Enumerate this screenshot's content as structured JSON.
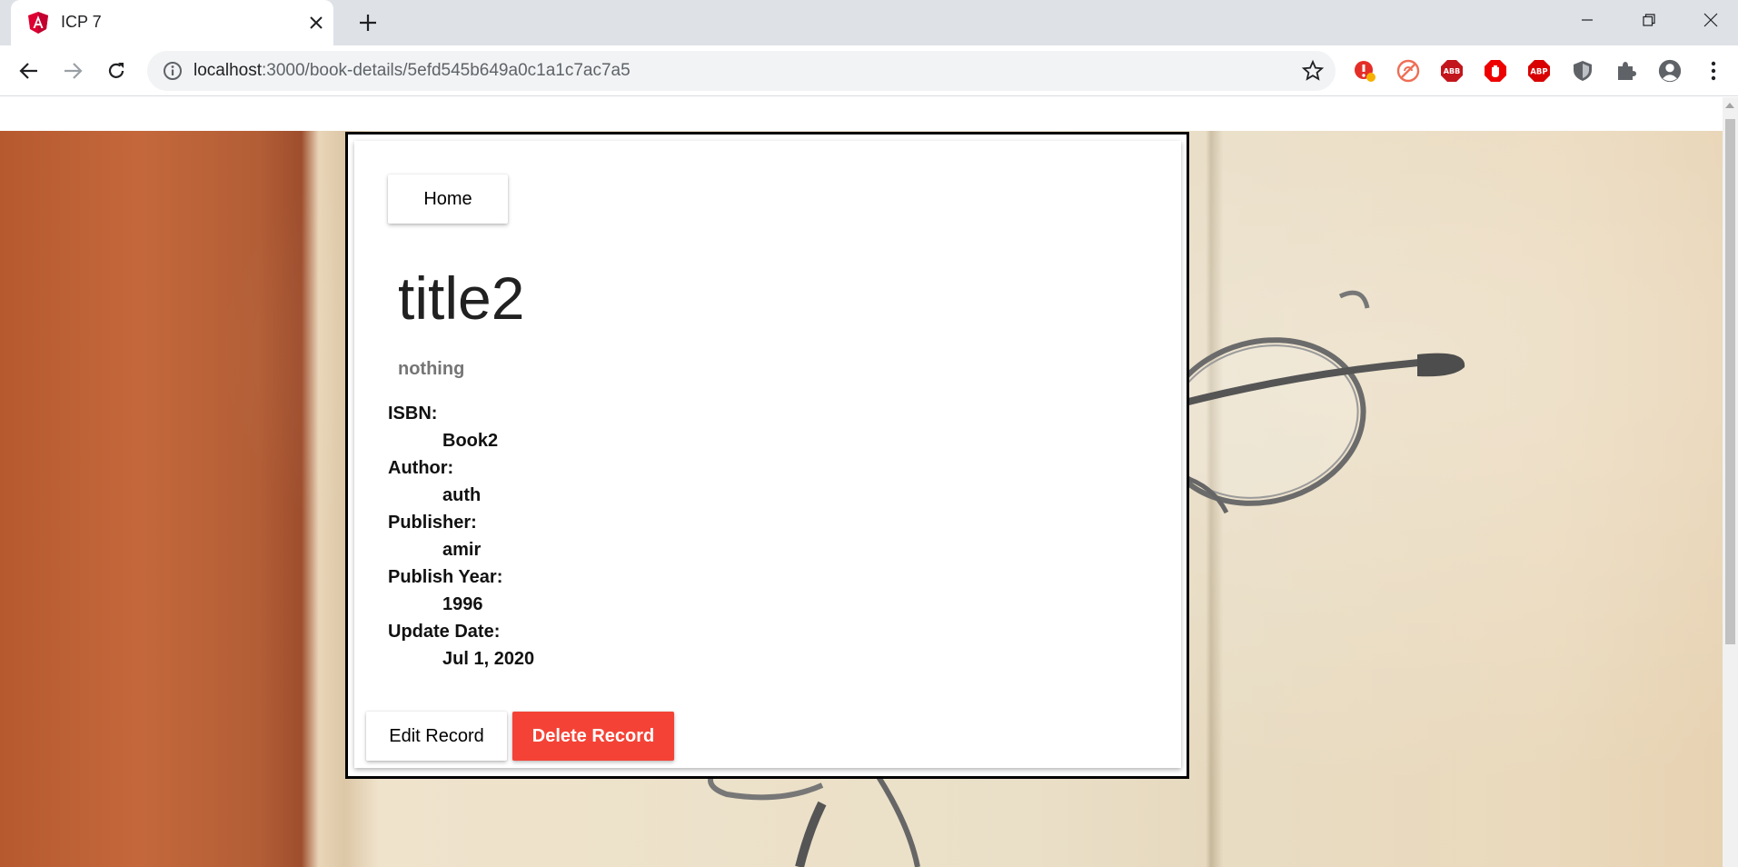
{
  "browser": {
    "tab_title": "ICP 7",
    "url_host": "localhost",
    "url_path": ":3000/book-details/5efd545b649a0c1a1c7ac7a5"
  },
  "icons": {
    "favicon": "angular-icon",
    "extensions": [
      "extension-alert-icon",
      "extension-stop-icon",
      "adblock-icon",
      "adblock-hand-icon",
      "adblock-plus-icon",
      "shield-icon",
      "puzzle-icon",
      "profile-icon"
    ]
  },
  "page": {
    "home_label": "Home",
    "title": "title2",
    "description": "nothing",
    "details": [
      {
        "label": "ISBN:",
        "value": "Book2"
      },
      {
        "label": "Author:",
        "value": "auth"
      },
      {
        "label": "Publisher:",
        "value": "amir"
      },
      {
        "label": "Publish Year:",
        "value": "1996"
      },
      {
        "label": "Update Date:",
        "value": "Jul 1, 2020"
      }
    ],
    "edit_label": "Edit Record",
    "delete_label": "Delete Record"
  },
  "colors": {
    "delete_button": "#f44336",
    "tabstrip": "#dee1e6"
  }
}
